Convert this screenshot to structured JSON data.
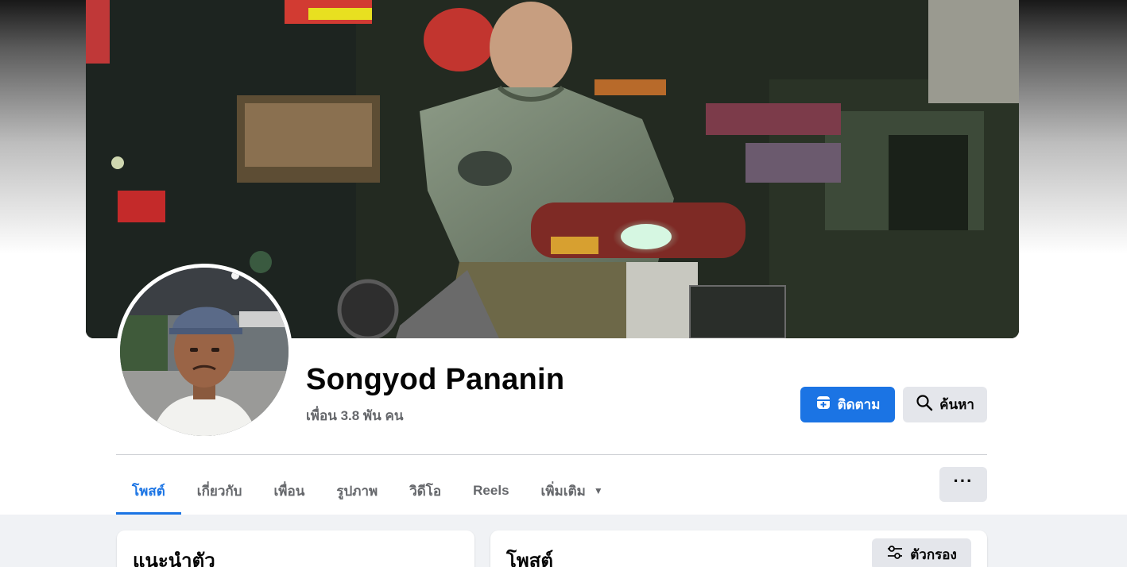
{
  "profile": {
    "name": "Songyod Pananin",
    "friends_text": "เพื่อน 3.8 พัน คน"
  },
  "actions": {
    "follow_label": "ติดตาม",
    "follow_icon": "follow-box-plus-icon",
    "search_label": "ค้นหา",
    "search_icon": "search-icon",
    "more_label": "···"
  },
  "tabs": [
    {
      "label": "โพสต์",
      "active": true
    },
    {
      "label": "เกี่ยวกับ"
    },
    {
      "label": "เพื่อน"
    },
    {
      "label": "รูปภาพ"
    },
    {
      "label": "วิดีโอ"
    },
    {
      "label": "Reels"
    },
    {
      "label": "เพิ่มเติม",
      "caret": "▼"
    }
  ],
  "intro_card": {
    "title": "แนะนำตัว"
  },
  "posts_card": {
    "title": "โพสต์",
    "filter_label": "ตัวกรอง",
    "filter_icon": "filter-sliders-icon"
  },
  "colors": {
    "accent": "#1b74e4",
    "secondary_button": "#e4e6eb",
    "muted_text": "#65676b",
    "background": "#f0f2f5"
  }
}
